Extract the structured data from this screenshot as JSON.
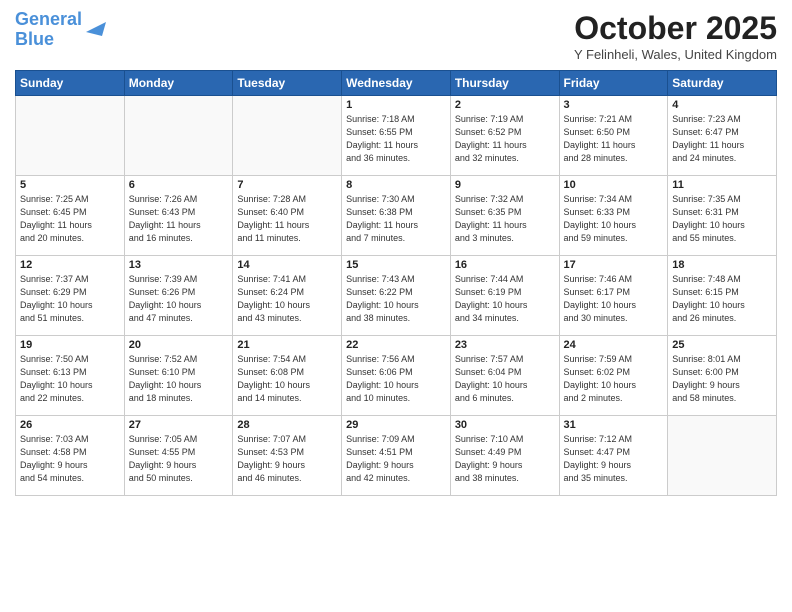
{
  "header": {
    "logo_line1": "General",
    "logo_line2": "Blue",
    "month_title": "October 2025",
    "location": "Y Felinheli, Wales, United Kingdom"
  },
  "days_of_week": [
    "Sunday",
    "Monday",
    "Tuesday",
    "Wednesday",
    "Thursday",
    "Friday",
    "Saturday"
  ],
  "weeks": [
    [
      {
        "day": "",
        "content": ""
      },
      {
        "day": "",
        "content": ""
      },
      {
        "day": "",
        "content": ""
      },
      {
        "day": "1",
        "content": "Sunrise: 7:18 AM\nSunset: 6:55 PM\nDaylight: 11 hours\nand 36 minutes."
      },
      {
        "day": "2",
        "content": "Sunrise: 7:19 AM\nSunset: 6:52 PM\nDaylight: 11 hours\nand 32 minutes."
      },
      {
        "day": "3",
        "content": "Sunrise: 7:21 AM\nSunset: 6:50 PM\nDaylight: 11 hours\nand 28 minutes."
      },
      {
        "day": "4",
        "content": "Sunrise: 7:23 AM\nSunset: 6:47 PM\nDaylight: 11 hours\nand 24 minutes."
      }
    ],
    [
      {
        "day": "5",
        "content": "Sunrise: 7:25 AM\nSunset: 6:45 PM\nDaylight: 11 hours\nand 20 minutes."
      },
      {
        "day": "6",
        "content": "Sunrise: 7:26 AM\nSunset: 6:43 PM\nDaylight: 11 hours\nand 16 minutes."
      },
      {
        "day": "7",
        "content": "Sunrise: 7:28 AM\nSunset: 6:40 PM\nDaylight: 11 hours\nand 11 minutes."
      },
      {
        "day": "8",
        "content": "Sunrise: 7:30 AM\nSunset: 6:38 PM\nDaylight: 11 hours\nand 7 minutes."
      },
      {
        "day": "9",
        "content": "Sunrise: 7:32 AM\nSunset: 6:35 PM\nDaylight: 11 hours\nand 3 minutes."
      },
      {
        "day": "10",
        "content": "Sunrise: 7:34 AM\nSunset: 6:33 PM\nDaylight: 10 hours\nand 59 minutes."
      },
      {
        "day": "11",
        "content": "Sunrise: 7:35 AM\nSunset: 6:31 PM\nDaylight: 10 hours\nand 55 minutes."
      }
    ],
    [
      {
        "day": "12",
        "content": "Sunrise: 7:37 AM\nSunset: 6:29 PM\nDaylight: 10 hours\nand 51 minutes."
      },
      {
        "day": "13",
        "content": "Sunrise: 7:39 AM\nSunset: 6:26 PM\nDaylight: 10 hours\nand 47 minutes."
      },
      {
        "day": "14",
        "content": "Sunrise: 7:41 AM\nSunset: 6:24 PM\nDaylight: 10 hours\nand 43 minutes."
      },
      {
        "day": "15",
        "content": "Sunrise: 7:43 AM\nSunset: 6:22 PM\nDaylight: 10 hours\nand 38 minutes."
      },
      {
        "day": "16",
        "content": "Sunrise: 7:44 AM\nSunset: 6:19 PM\nDaylight: 10 hours\nand 34 minutes."
      },
      {
        "day": "17",
        "content": "Sunrise: 7:46 AM\nSunset: 6:17 PM\nDaylight: 10 hours\nand 30 minutes."
      },
      {
        "day": "18",
        "content": "Sunrise: 7:48 AM\nSunset: 6:15 PM\nDaylight: 10 hours\nand 26 minutes."
      }
    ],
    [
      {
        "day": "19",
        "content": "Sunrise: 7:50 AM\nSunset: 6:13 PM\nDaylight: 10 hours\nand 22 minutes."
      },
      {
        "day": "20",
        "content": "Sunrise: 7:52 AM\nSunset: 6:10 PM\nDaylight: 10 hours\nand 18 minutes."
      },
      {
        "day": "21",
        "content": "Sunrise: 7:54 AM\nSunset: 6:08 PM\nDaylight: 10 hours\nand 14 minutes."
      },
      {
        "day": "22",
        "content": "Sunrise: 7:56 AM\nSunset: 6:06 PM\nDaylight: 10 hours\nand 10 minutes."
      },
      {
        "day": "23",
        "content": "Sunrise: 7:57 AM\nSunset: 6:04 PM\nDaylight: 10 hours\nand 6 minutes."
      },
      {
        "day": "24",
        "content": "Sunrise: 7:59 AM\nSunset: 6:02 PM\nDaylight: 10 hours\nand 2 minutes."
      },
      {
        "day": "25",
        "content": "Sunrise: 8:01 AM\nSunset: 6:00 PM\nDaylight: 9 hours\nand 58 minutes."
      }
    ],
    [
      {
        "day": "26",
        "content": "Sunrise: 7:03 AM\nSunset: 4:58 PM\nDaylight: 9 hours\nand 54 minutes."
      },
      {
        "day": "27",
        "content": "Sunrise: 7:05 AM\nSunset: 4:55 PM\nDaylight: 9 hours\nand 50 minutes."
      },
      {
        "day": "28",
        "content": "Sunrise: 7:07 AM\nSunset: 4:53 PM\nDaylight: 9 hours\nand 46 minutes."
      },
      {
        "day": "29",
        "content": "Sunrise: 7:09 AM\nSunset: 4:51 PM\nDaylight: 9 hours\nand 42 minutes."
      },
      {
        "day": "30",
        "content": "Sunrise: 7:10 AM\nSunset: 4:49 PM\nDaylight: 9 hours\nand 38 minutes."
      },
      {
        "day": "31",
        "content": "Sunrise: 7:12 AM\nSunset: 4:47 PM\nDaylight: 9 hours\nand 35 minutes."
      },
      {
        "day": "",
        "content": ""
      }
    ]
  ]
}
